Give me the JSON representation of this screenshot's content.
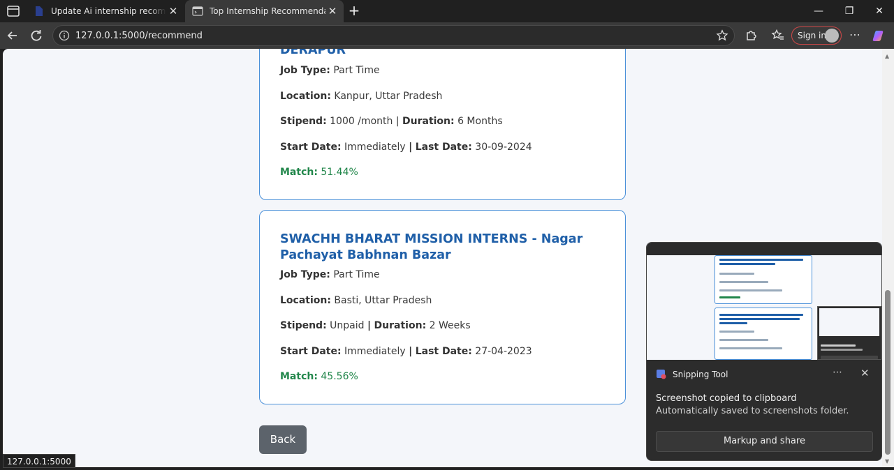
{
  "browser": {
    "tabs": [
      {
        "title": "Update Ai internship recommend"
      },
      {
        "title": "Top Internship Recommendations"
      }
    ],
    "url": "127.0.0.1:5000/recommend",
    "signin_label": "Sign in",
    "status_url": "127.0.0.1:5000"
  },
  "cards": [
    {
      "title": "DERAPUR",
      "job_type_label": "Job Type:",
      "job_type": "Part Time",
      "location_label": "Location:",
      "location": "Kanpur, Uttar Pradesh",
      "stipend_label": "Stipend:",
      "stipend": "1000 /month",
      "duration_label": "Duration:",
      "duration": "6 Months",
      "start_label": "Start Date:",
      "start": "Immediately",
      "last_label": "Last Date:",
      "last": "30-09-2024",
      "match_label": "Match:",
      "match": "51.44%"
    },
    {
      "title": "SWACHH BHARAT MISSION INTERNS - Nagar Pachayat Babhnan Bazar",
      "job_type_label": "Job Type:",
      "job_type": "Part Time",
      "location_label": "Location:",
      "location": "Basti, Uttar Pradesh",
      "stipend_label": "Stipend:",
      "stipend": "Unpaid",
      "duration_label": "Duration:",
      "duration": "2 Weeks",
      "start_label": "Start Date:",
      "start": "Immediately",
      "last_label": "Last Date:",
      "last": "27-04-2023",
      "match_label": "Match:",
      "match": "45.56%"
    }
  ],
  "separator": "|",
  "back_label": "Back",
  "toast": {
    "app_name": "Snipping Tool",
    "message": "Screenshot copied to clipboard",
    "sub_message": "Automatically saved to screenshots folder.",
    "action_label": "Markup and share"
  },
  "colors": {
    "title": "#1f5fa8",
    "match": "#21864a",
    "card_border": "#4a90d9",
    "back_button": "#5c636b"
  }
}
